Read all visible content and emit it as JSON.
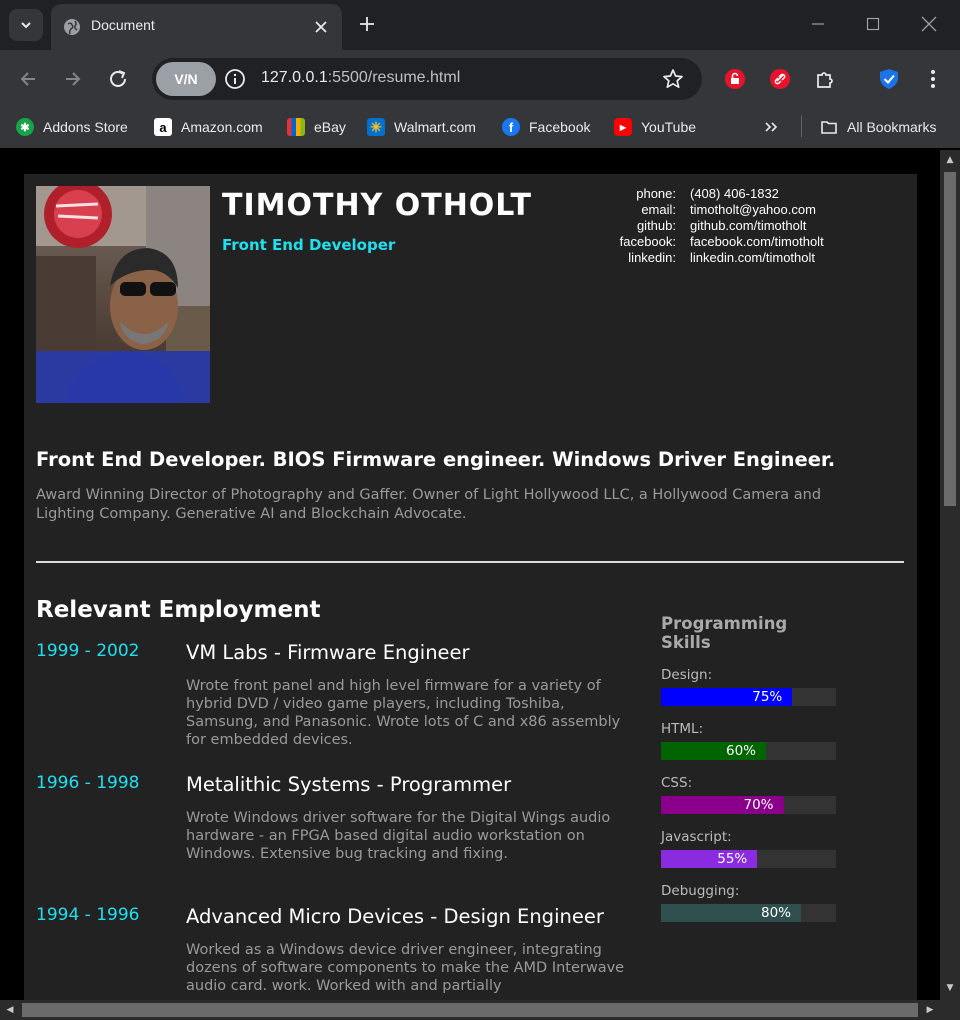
{
  "browser": {
    "tab_title": "Document",
    "url_host": "127.0.0.1",
    "url_rest": ":5500/resume.html",
    "vpn_label": "V/N",
    "bookmarks": [
      "Addons Store",
      "Amazon.com",
      "eBay",
      "Walmart.com",
      "Facebook",
      "YouTube"
    ],
    "all_bookmarks": "All Bookmarks"
  },
  "profile": {
    "name": "TIMOTHY OTHOLT",
    "role": "Front End Developer",
    "contacts": [
      {
        "label": "phone:",
        "value": "(408) 406-1832"
      },
      {
        "label": "email:",
        "value": "timotholt@yahoo.com"
      },
      {
        "label": "github:",
        "value": "github.com/timotholt"
      },
      {
        "label": "facebook:",
        "value": "facebook.com/timotholt"
      },
      {
        "label": "linkedin:",
        "value": "linkedin.com/timotholt"
      }
    ],
    "headline": "Front End Developer. BIOS Firmware engineer. Windows Driver Engineer.",
    "summary": "Award Winning Director of Photography and Gaffer. Owner of Light Hollywood LLC, a Hollywood Camera and Lighting Company. Generative AI and Blockchain Advocate."
  },
  "employment": {
    "title": "Relevant Employment",
    "jobs": [
      {
        "years": "1999 - 2002",
        "title": "VM Labs - Firmware Engineer",
        "desc": "Wrote front panel and high level firmware for a variety of hybrid DVD / video game players, including Toshiba, Samsung, and Panasonic. Wrote lots of C and x86 assembly for embedded devices."
      },
      {
        "years": "1996 - 1998",
        "title": "Metalithic Systems - Programmer",
        "desc": "Wrote Windows driver software for the Digital Wings audio hardware - an FPGA based digital audio workstation on Windows. Extensive bug tracking and fixing."
      },
      {
        "years": "1994 - 1996",
        "title": "Advanced Micro Devices - Design Engineer",
        "desc": "Worked as a Windows device driver engineer, integrating dozens of software components to make the AMD Interwave audio card. work. Worked with and partially"
      }
    ]
  },
  "skills": {
    "title": "Programming Skills",
    "items": [
      {
        "name": "Design:",
        "label": "75%",
        "value": 0.75,
        "color": "#0000ff"
      },
      {
        "name": "HTML:",
        "label": "60%",
        "value": 0.6,
        "color": "#006400"
      },
      {
        "name": "CSS:",
        "label": "70%",
        "value": 0.7,
        "color": "#8b008b"
      },
      {
        "name": "Javascript:",
        "label": "55%",
        "value": 0.55,
        "color": "#8a2be2"
      },
      {
        "name": "Debugging:",
        "label": "80%",
        "value": 0.8,
        "color": "#2f4f4f"
      }
    ]
  }
}
